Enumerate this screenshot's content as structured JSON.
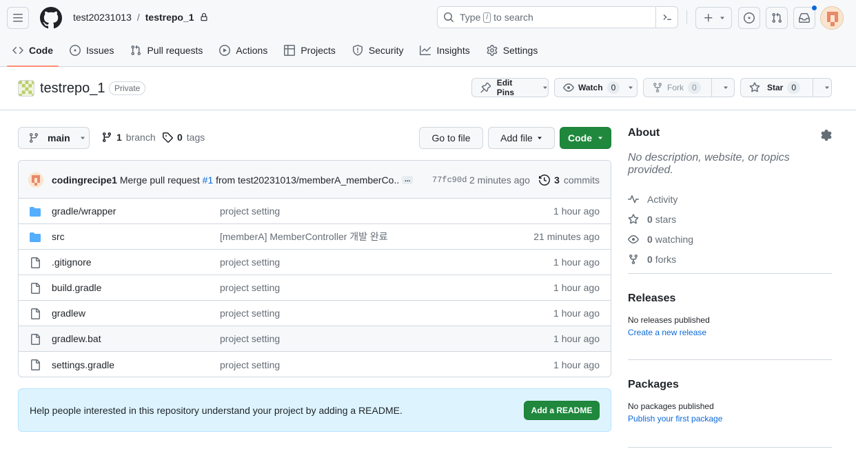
{
  "header": {
    "owner": "test20231013",
    "separator": "/",
    "repo": "testrepo_1",
    "search_prefix": "Type",
    "search_key": "/",
    "search_suffix": "to search"
  },
  "tabs": [
    {
      "label": "Code",
      "icon": "code-icon"
    },
    {
      "label": "Issues",
      "icon": "issue-icon"
    },
    {
      "label": "Pull requests",
      "icon": "pull-request-icon"
    },
    {
      "label": "Actions",
      "icon": "play-icon"
    },
    {
      "label": "Projects",
      "icon": "table-icon"
    },
    {
      "label": "Security",
      "icon": "shield-icon"
    },
    {
      "label": "Insights",
      "icon": "graph-icon"
    },
    {
      "label": "Settings",
      "icon": "gear-icon"
    }
  ],
  "repo_head": {
    "name": "testrepo_1",
    "visibility": "Private",
    "edit_pins": "Edit Pins",
    "watch": "Watch",
    "watch_count": "0",
    "fork": "Fork",
    "fork_count": "0",
    "star": "Star",
    "star_count": "0"
  },
  "toolbar": {
    "branch": "main",
    "branch_count": "1",
    "branch_label": "branch",
    "tag_count": "0",
    "tag_label": "tags",
    "go_to_file": "Go to file",
    "add_file": "Add file",
    "code": "Code"
  },
  "commit": {
    "author": "codingrecipe1",
    "message_pre": "Merge pull request",
    "pr_ref": "#1",
    "message_post": "from test20231013/memberA_memberCo...",
    "ellipsis": "...",
    "sha": "77fc90d",
    "time": "2 minutes ago",
    "commit_count": "3",
    "commit_label": "commits"
  },
  "files": [
    {
      "name": "gradle/wrapper",
      "type": "folder",
      "message": "project setting",
      "time": "1 hour ago"
    },
    {
      "name": "src",
      "type": "folder",
      "message": "[memberA] MemberController 개발 완료",
      "time": "21 minutes ago"
    },
    {
      "name": ".gitignore",
      "type": "file",
      "message": "project setting",
      "time": "1 hour ago"
    },
    {
      "name": "build.gradle",
      "type": "file",
      "message": "project setting",
      "time": "1 hour ago"
    },
    {
      "name": "gradlew",
      "type": "file",
      "message": "project setting",
      "time": "1 hour ago"
    },
    {
      "name": "gradlew.bat",
      "type": "file",
      "message": "project setting",
      "time": "1 hour ago"
    },
    {
      "name": "settings.gradle",
      "type": "file",
      "message": "project setting",
      "time": "1 hour ago"
    }
  ],
  "readme": {
    "text": "Help people interested in this repository understand your project by adding a README.",
    "button": "Add a README"
  },
  "about": {
    "title": "About",
    "description": "No description, website, or topics provided.",
    "activity": "Activity",
    "stars_count": "0",
    "stars_label": "stars",
    "watching_count": "0",
    "watching_label": "watching",
    "forks_count": "0",
    "forks_label": "forks"
  },
  "releases": {
    "title": "Releases",
    "empty": "No releases published",
    "link": "Create a new release"
  },
  "packages": {
    "title": "Packages",
    "empty": "No packages published",
    "link": "Publish your first package"
  },
  "colors": {
    "primary_green": "#1f883d",
    "link_blue": "#0969da",
    "tab_underline": "#fd8c73",
    "folder_blue": "#54aeff",
    "banner_bg": "#ddf4ff"
  }
}
